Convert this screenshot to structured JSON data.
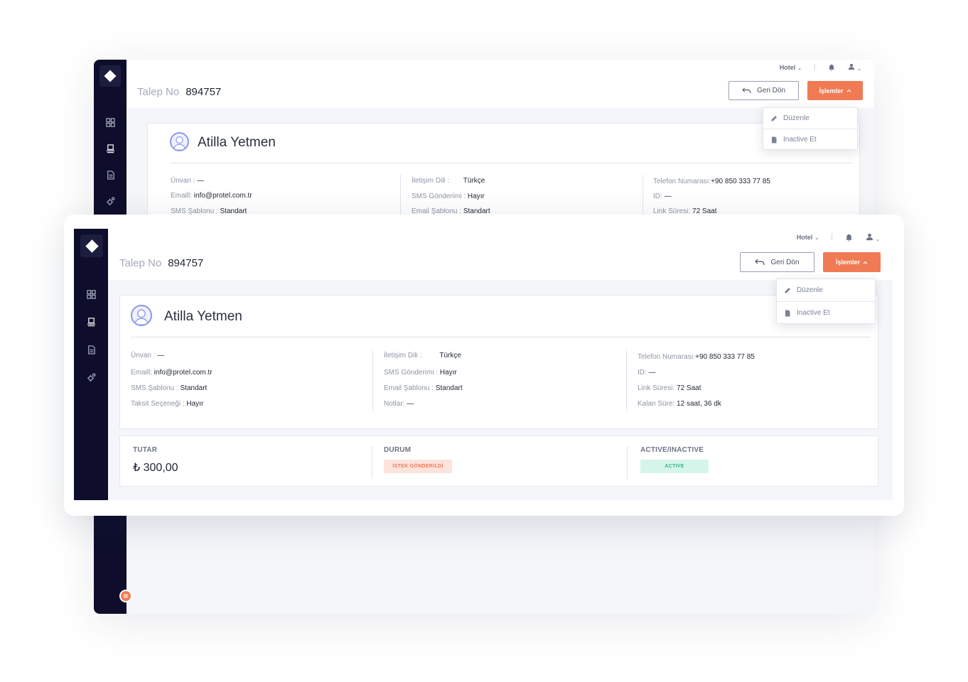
{
  "topbar": {
    "hotel_label": "Hotel"
  },
  "header": {
    "talep_label": "Talep No",
    "talep_no": "894757",
    "back_button": "Geri Dön",
    "actions_button": "İşlemler"
  },
  "dropdown": {
    "edit": "Düzenle",
    "inactive": "Inactive Et"
  },
  "user": {
    "name": "Atilla Yetmen"
  },
  "details": {
    "col1": [
      {
        "label": "Ünvan :",
        "value": "—"
      },
      {
        "label": "Emaill:",
        "value": "info@protel.com.tr"
      },
      {
        "label": "SMS Şablonu :",
        "value": "Standart"
      },
      {
        "label": "Taksit Seçeneği :",
        "value": "Hayır"
      }
    ],
    "col2": [
      {
        "label": "İletişim Dili :",
        "value": "Türkçe"
      },
      {
        "label": "SMS Gönderimi :",
        "value": "Hayır"
      },
      {
        "label": "Email Şablonu :",
        "value": "Standart"
      },
      {
        "label": "Notlar:",
        "value": "—"
      }
    ],
    "col3": [
      {
        "label": "Telefon Numarası:",
        "value": "+90 850 333 77 85"
      },
      {
        "label": "ID:",
        "value": "—"
      },
      {
        "label": "Link Süresi:",
        "value": "72 Saat"
      },
      {
        "label": "Kalan Süre:",
        "value": "12 saat, 36 dk"
      }
    ]
  },
  "summary": {
    "tutar_label": "TUTAR",
    "tutar_value": "₺ 300,00",
    "durum_label": "DURUM",
    "durum_value": "İSTEK GÖNDERİLDİ",
    "active_label": "ACTIVE/INACTIVE",
    "active_value": "ACTIVE"
  },
  "colors": {
    "sidebar": "#0e0e2c",
    "accent": "#f07a54",
    "status_pending_bg": "#fde3dc",
    "status_pending_text": "#f07a54",
    "status_active_bg": "#d6f5ea",
    "status_active_text": "#2bb98a"
  },
  "icons": [
    "diamond-logo-icon",
    "grid-icon",
    "desk-icon",
    "document-icon",
    "settings-icon",
    "bell-icon",
    "user-icon",
    "back-arrow-icon",
    "pencil-icon",
    "file-icon",
    "chevron-up-icon",
    "chevron-down-icon",
    "menu-icon"
  ]
}
